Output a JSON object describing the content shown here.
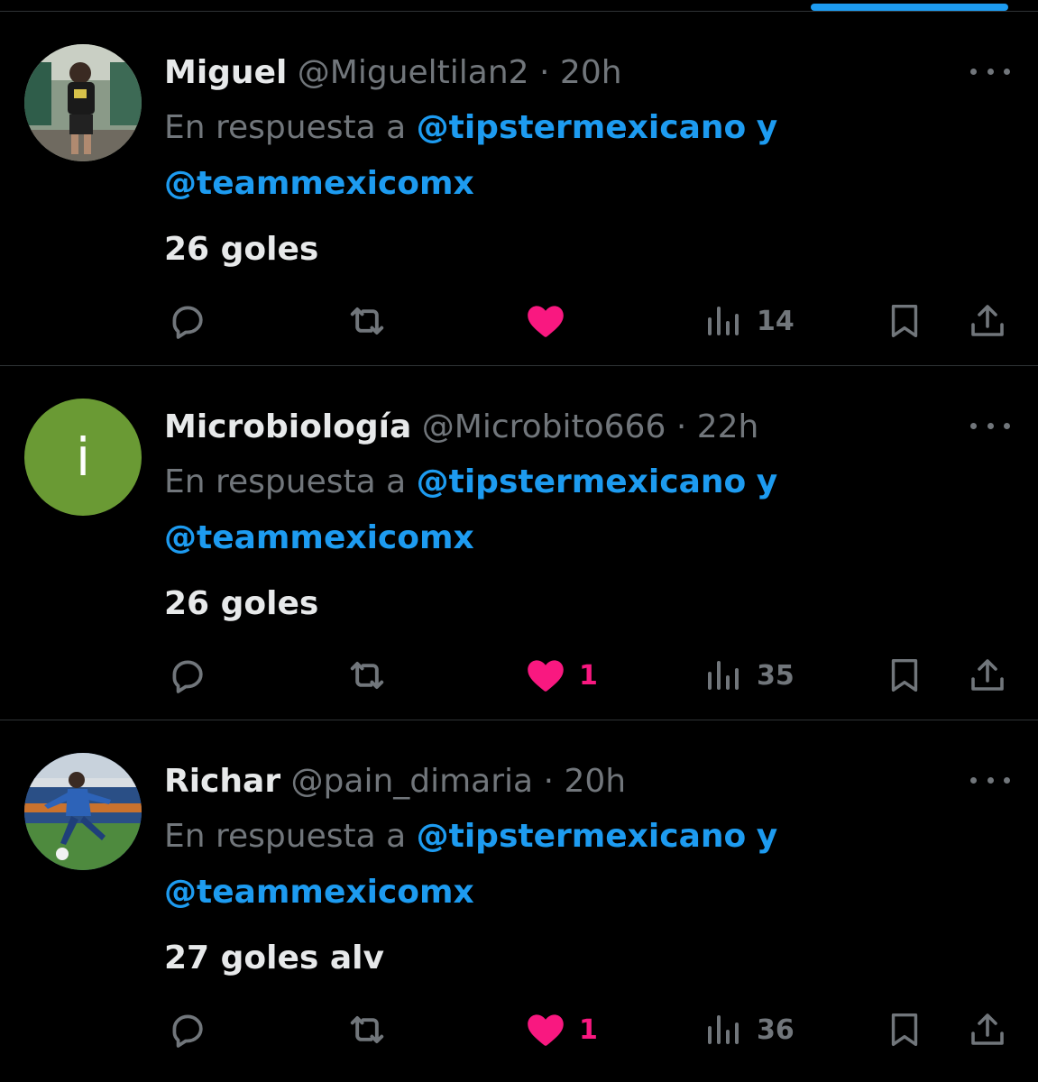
{
  "colors": {
    "background": "#000000",
    "accent_blue": "#1d9bf0",
    "like_pink": "#f91880",
    "muted_gray": "#71767b",
    "text": "#e7e9ea",
    "divider": "#2f3336"
  },
  "tweets": [
    {
      "name": "Miguel",
      "handle": "@Migueltilan2",
      "separator": "·",
      "time": "20h",
      "reply_prefix": "En respuesta a",
      "reply_to_1": "@tipstermexicano",
      "reply_and": "y",
      "reply_to_2": "@teammexicomx",
      "text": "26 goles",
      "avatar": {
        "type": "photo",
        "icon": "avatar-photo"
      },
      "actions": {
        "reply_icon": "reply-icon",
        "retweet_icon": "retweet-icon",
        "like_icon": "heart-filled-icon",
        "like_count": "",
        "liked": true,
        "views_icon": "views-icon",
        "views_count": "14",
        "bookmark_icon": "bookmark-icon",
        "share_icon": "share-icon"
      }
    },
    {
      "name": "Microbiología",
      "handle": "@Microbito666",
      "separator": "·",
      "time": "22h",
      "reply_prefix": "En respuesta a",
      "reply_to_1": "@tipstermexicano",
      "reply_and": "y",
      "reply_to_2": "@teammexicomx",
      "text": "26 goles",
      "avatar": {
        "type": "letter",
        "letter": "i",
        "color": "#6a9a34"
      },
      "actions": {
        "reply_icon": "reply-icon",
        "retweet_icon": "retweet-icon",
        "like_icon": "heart-filled-icon",
        "like_count": "1",
        "liked": true,
        "views_icon": "views-icon",
        "views_count": "35",
        "bookmark_icon": "bookmark-icon",
        "share_icon": "share-icon"
      }
    },
    {
      "name": "Richar",
      "handle": "@pain_dimaria",
      "separator": "·",
      "time": "20h",
      "reply_prefix": "En respuesta a",
      "reply_to_1": "@tipstermexicano",
      "reply_and": "y",
      "reply_to_2": "@teammexicomx",
      "text": "27 goles alv",
      "avatar": {
        "type": "photo",
        "icon": "avatar-photo"
      },
      "actions": {
        "reply_icon": "reply-icon",
        "retweet_icon": "retweet-icon",
        "like_icon": "heart-filled-icon",
        "like_count": "1",
        "liked": true,
        "views_icon": "views-icon",
        "views_count": "36",
        "bookmark_icon": "bookmark-icon",
        "share_icon": "share-icon"
      }
    }
  ]
}
